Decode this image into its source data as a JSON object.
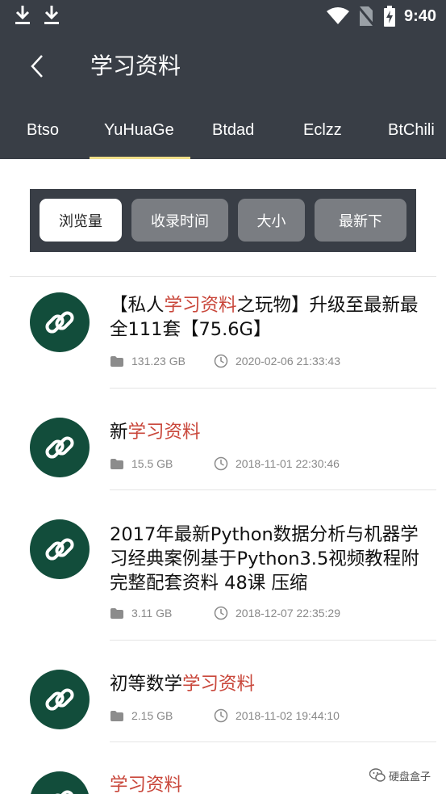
{
  "status_bar": {
    "time": "9:40"
  },
  "header": {
    "title": "学习资料"
  },
  "tabs": [
    {
      "label": "Btso"
    },
    {
      "label": "YuHuaGe",
      "active": true
    },
    {
      "label": "Btdad"
    },
    {
      "label": "Eclzz"
    },
    {
      "label": "BtChili"
    }
  ],
  "filters": [
    {
      "label": "浏览量",
      "active": true
    },
    {
      "label": "收录时间"
    },
    {
      "label": "大小"
    },
    {
      "label": "最新下"
    }
  ],
  "items": [
    {
      "title_parts": [
        "【私人",
        "学习资料",
        "之玩物】升级至最新最全111套【75.6G】"
      ],
      "size": "131.23 GB",
      "date": "2020-02-06 21:33:43"
    },
    {
      "title_parts": [
        "新",
        "学习资料",
        ""
      ],
      "size": "15.5 GB",
      "date": "2018-11-01 22:30:46"
    },
    {
      "title_parts": [
        "2017年最新Python数据分析与机器学习经典案例基于Python3.5视频教程附完整配套资料 48课 压缩",
        "",
        ""
      ],
      "size": "3.11 GB",
      "date": "2018-12-07 22:35:29"
    },
    {
      "title_parts": [
        "初等数学",
        "学习资料",
        ""
      ],
      "size": "2.15 GB",
      "date": "2018-11-02 19:44:10"
    },
    {
      "title_parts": [
        "",
        "学习资料",
        ""
      ]
    }
  ],
  "watermark": {
    "text": "硬盘盒子"
  },
  "colors": {
    "toolbar": "#393e46",
    "accent_underline": "#f1e08a",
    "highlight_text": "#c9473b",
    "avatar_bg": "#124d3b"
  },
  "icons": [
    "download-icon",
    "wifi-icon",
    "no-sim-icon",
    "battery-charging-icon",
    "back-arrow-icon",
    "link-icon",
    "folder-icon",
    "clock-icon",
    "wechat-icon"
  ]
}
